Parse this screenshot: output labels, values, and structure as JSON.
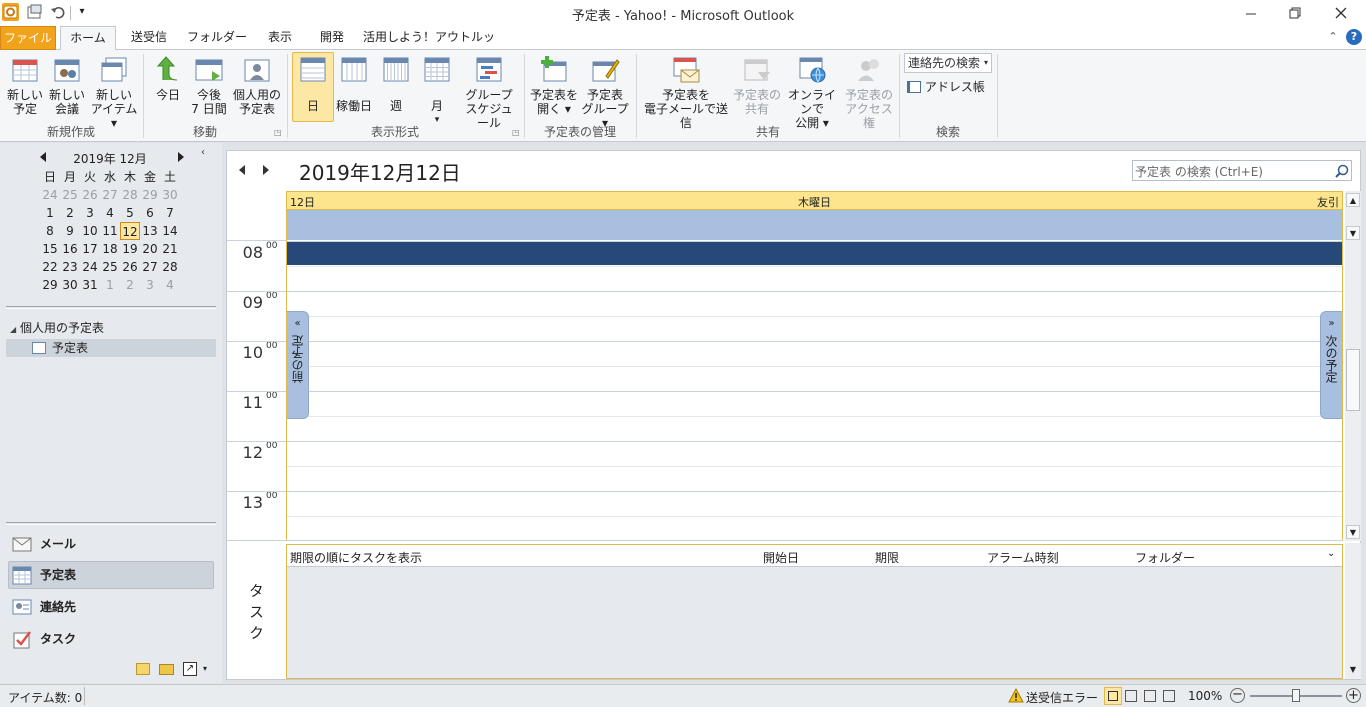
{
  "window": {
    "title": "予定表 - Yahoo!  -  Microsoft Outlook"
  },
  "tabs": [
    {
      "label": "ファイル"
    },
    {
      "label": "ホーム"
    },
    {
      "label": "送受信"
    },
    {
      "label": "フォルダー"
    },
    {
      "label": "表示"
    },
    {
      "label": "開発"
    },
    {
      "label": "活用しよう！アウトルック"
    }
  ],
  "ribbon": {
    "new_group": {
      "label": "新規作成",
      "new_appt": [
        "新しい",
        "予定"
      ],
      "new_meeting": [
        "新しい",
        "会議"
      ],
      "new_items": [
        "新しい",
        "アイテム ▾"
      ]
    },
    "goto_group": {
      "label": "移動",
      "today": "今日",
      "next7": [
        "今後",
        "7 日間"
      ],
      "personal": [
        "個人用の",
        "予定表"
      ]
    },
    "arrange_group": {
      "label": "表示形式",
      "day": "日",
      "workweek": "稼働日",
      "week": "週",
      "month": "月",
      "month_arrow": "▾",
      "group": [
        "グループ",
        "スケジュール"
      ]
    },
    "manage_group": {
      "label": "予定表の管理",
      "open": [
        "予定表を",
        "開く ▾"
      ],
      "groups": [
        "予定表",
        "グループ ▾"
      ]
    },
    "share_group": {
      "label": "共有",
      "email": [
        "予定表を",
        "電子メールで送信"
      ],
      "share": [
        "予定表の",
        "共有"
      ],
      "publish": [
        "オンラインで",
        "公開 ▾"
      ],
      "permissions": [
        "予定表の",
        "アクセス権"
      ]
    },
    "find_group": {
      "label": "検索",
      "search_contacts": "連絡先の検索",
      "address_book": "アドレス帳"
    }
  },
  "nav_calendar": {
    "month_title": "2019年 12月",
    "weekdays": [
      "日",
      "月",
      "火",
      "水",
      "木",
      "金",
      "土"
    ],
    "weeks": [
      [
        "24",
        "25",
        "26",
        "27",
        "28",
        "29",
        "30"
      ],
      [
        "1",
        "2",
        "3",
        "4",
        "5",
        "6",
        "7"
      ],
      [
        "8",
        "9",
        "10",
        "11",
        "12",
        "13",
        "14"
      ],
      [
        "15",
        "16",
        "17",
        "18",
        "19",
        "20",
        "21"
      ],
      [
        "22",
        "23",
        "24",
        "25",
        "26",
        "27",
        "28"
      ],
      [
        "29",
        "30",
        "31",
        "1",
        "2",
        "3",
        "4"
      ]
    ],
    "selected": "12"
  },
  "folders": {
    "group": "個人用の予定表",
    "item": "予定表"
  },
  "nav_buttons": [
    {
      "label": "メール"
    },
    {
      "label": "予定表"
    },
    {
      "label": "連絡先"
    },
    {
      "label": "タスク"
    }
  ],
  "main": {
    "date_title": "2019年12月12日",
    "search_placeholder": "予定表 の検索 (Ctrl+E)",
    "day_header": {
      "day": "12日",
      "weekday": "木曜日",
      "rokuyo": "友引"
    },
    "hours": [
      {
        "h": "08",
        "m": "00"
      },
      {
        "h": "09",
        "m": "00"
      },
      {
        "h": "10",
        "m": "00"
      },
      {
        "h": "11",
        "m": "00"
      },
      {
        "h": "12",
        "m": "00"
      },
      {
        "h": "13",
        "m": "00"
      }
    ],
    "prev_appt": "前の予定",
    "next_appt": "次の予定",
    "tasks_label": "タスク",
    "task_columns": {
      "subject": "期限の順にタスクを表示",
      "start": "開始日",
      "due": "期限",
      "reminder": "アラーム時刻",
      "folder": "フォルダー"
    }
  },
  "status": {
    "items": "アイテム数: 0",
    "error": "送受信エラー",
    "zoom": "100%"
  },
  "colors": {
    "accent": "#f2a31c",
    "header_yellow": "#fce58c",
    "selected_slot": "#27497a",
    "allday": "#a8bfdf"
  }
}
